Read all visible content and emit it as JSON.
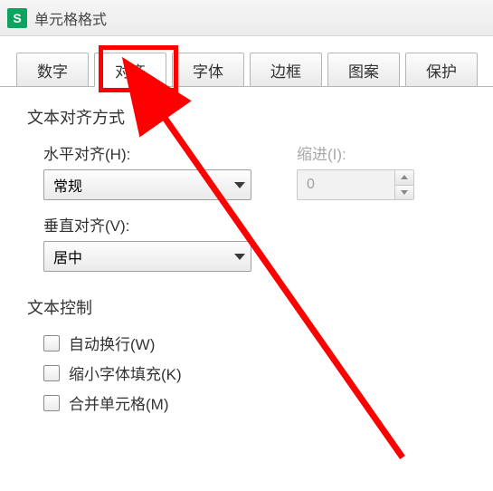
{
  "window": {
    "title": "单元格格式",
    "icon_letter": "S"
  },
  "tabs": [
    "数字",
    "对齐",
    "字体",
    "边框",
    "图案",
    "保护"
  ],
  "active_tab_index": 1,
  "align_section": {
    "title": "文本对齐方式",
    "h_label": "水平对齐(H):",
    "h_value": "常规",
    "indent_label": "缩进(I):",
    "indent_value": "0",
    "v_label": "垂直对齐(V):",
    "v_value": "居中"
  },
  "text_control": {
    "title": "文本控制",
    "wrap": "自动换行(W)",
    "shrink": "缩小字体填充(K)",
    "merge": "合并单元格(M)"
  }
}
